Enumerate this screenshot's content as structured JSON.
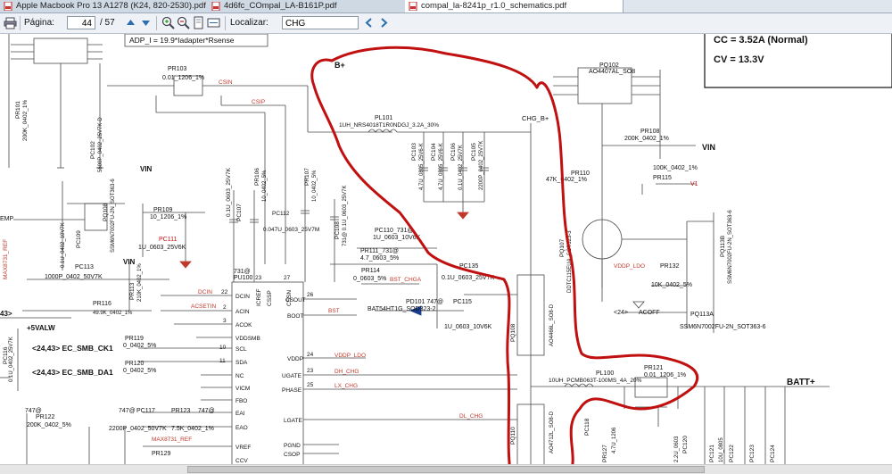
{
  "tabs": [
    {
      "label": "Apple Macbook Pro 13 A1278 (K24, 820-2530).pdf",
      "active": false
    },
    {
      "label": "4d6fc_COmpal_LA-B161P.pdf",
      "active": false
    },
    {
      "label": "compal_la-8241p_r1.0_schematics.pdf",
      "active": true
    }
  ],
  "toolbar": {
    "page_label": "Página:",
    "page_current": "44",
    "page_total": "/ 57",
    "search_label": "Localizar:",
    "search_value": "CHG"
  },
  "schematic": {
    "formula": "ADP_I = 19.9*Iadapter*Rsense",
    "note_cc": "CC = 3.52A (Normal)",
    "note_cv": "CV = 13.3V",
    "rails": {
      "bplus": "B+",
      "chg_bplus": "CHG_B+",
      "vin": "VIN",
      "batt": "BATT+",
      "valw": "+5VALW",
      "vin2": "VIN",
      "vin3": "VIN"
    },
    "nets": {
      "csin": "CSIN",
      "csip": "CSIP",
      "dcin": "DCIN",
      "acsetin": "ACSETIN",
      "bst_chga": "BST_CHGA",
      "bst": "BST",
      "vddp_ldo": "VDDP_LDO",
      "dh_chg": "DH_CHG",
      "lx_chg": "LX_CHG",
      "dl_chg": "DL_CHG",
      "vddp_ldo2": "VDDP_LDO",
      "acoff": "ACOFF",
      "v1": "V1",
      "max_ref": "MAX8731_REF",
      "max_ref2": "MAX8731_REF",
      "emp": "EMP"
    },
    "smb": {
      "ck": "<24,43> EC_SMB_CK1",
      "da": "<24,43> EC_SMB_DA1",
      "ref43": "43>",
      "ref24": "<24>"
    },
    "parts": {
      "pr101": "PR101",
      "pr101v": "200K_0402_1%",
      "pr103": "PR103",
      "pr103v": "0.01_1206_1%",
      "pc102": "PC102",
      "pc102v": "5600P_0402_25V7K-D",
      "pl101": "PL101",
      "pl101v": "1UH_NRS4018T1R0NDGJ_3.2A_30%",
      "pc103": "PC103",
      "pc103v": "4.7U_0805_25V6-K",
      "pc104": "PC104",
      "pc104v": "4.7U_0805_25V6-K",
      "pc106": "PC106",
      "pc106v": "0.1U_0402_25V7K",
      "pc105": "PC105",
      "pc105v": "2200P_0402_25V7K",
      "pq102": "PQ102",
      "pq102v": "AO4407AL_SO8",
      "pr108": "PR108",
      "pr108v": "200K_0402_1%",
      "pr110": "PR110",
      "pr110v": "47K_0402_1%",
      "pr115": "PR115",
      "pr115v": "100K_0402_1%",
      "pq107": "PQ107",
      "pq107v": "DDTC115EUA_SOT323-3",
      "pq113b": "PQ113B",
      "pq113bv": "SSM6N7002FU-2N_SOT363-6",
      "pr132": "PR132",
      "pr132v": "10K_0402_5%",
      "pq113a": "PQ113A",
      "pq113av": "SSM6N7002FU-2N_SOT363-6",
      "pr109": "PR109",
      "pr109v": "10_1206_1%",
      "pc111": "PC111",
      "pc111v": "1U_0603_25V6K",
      "pc107": "PC107",
      "pc107v": "0.1U_0603_25V7K",
      "pr106": "PR106",
      "pr106v": "10_0402_5%",
      "pr107": "PR107",
      "pr107v": "10_0402_5%",
      "pc112": "PC112",
      "pc112v": "0.047U_0603_25V7M",
      "pc108": "PC108",
      "pc108v": "731@ 0.1U_0603_25V7K",
      "pc110": "PC110_731@",
      "pc110v": "1U_0603_10V6K",
      "pr111": "PR111_731@",
      "pr111v": "4.7_0603_5%",
      "pr114": "PR114",
      "pr114v": "0_0603_5%",
      "pd101": "PD101 747@",
      "pd101v": "BAT54HT1G_SOD323-2",
      "pc115": "PC115",
      "pc115v": "1U_0603_10V6K",
      "pc135": "PC135",
      "pc135v": "0.1U_0603_25V7K",
      "pc109": "PC109",
      "pc109v": "0.1U_0402_10V7K",
      "pq108": "PQ108",
      "pq108v": "SSM6N7002FU-2N_SOT363-6",
      "pc113": "PC113",
      "pc113v": "1000P_0402_50V7K",
      "pr113": "PR113",
      "pr113v": "210K_0402_1%",
      "pr116": "PR116",
      "pr116v": "49.9K_0402_1%",
      "pr119": "PR119",
      "pr119v": "0_0402_5%",
      "pr120": "PR120",
      "pr120v": "0_0402_5%",
      "pr122": "PR122",
      "pr122v": "200K_0402_5%",
      "pc116": "PC116",
      "pc116v": "0.1U_0402_25V7K",
      "pc117": "PC117",
      "pc117v": "2200P_0402_50V7K",
      "pr123": "PR123",
      "pr123v": "7.5K_0402_1%",
      "pr129": "PR129",
      "pu100": "PU100",
      "pq108b": "PQ108",
      "pq108bv": "AO4466L_SO8-D",
      "pq110": "PQ110",
      "pq110v": "AO4712L_SO8-D",
      "pl100": "PL100",
      "pl100v": "10UH_PCMB063T-100MS_4A_20%",
      "pr121": "PR121",
      "pr121v": "0.01_1206_1%",
      "pc118": "PC118",
      "pc120": "PC120",
      "pc121": "PC121",
      "pc122": "PC122",
      "pc123": "PC123",
      "pc124": "PC124",
      "pr127": "PR127",
      "at731": "731@",
      "at747": "747@",
      "at747b": "747@",
      "at747c": "747@",
      "cap_4u7": "4.7U_1206",
      "cap_10u": "10U_0805",
      "cap_2u2": "2.2U_0603"
    },
    "ic_pins": [
      {
        "num": "22",
        "name": "DCIN"
      },
      {
        "num": "2",
        "name": "ACIN"
      },
      {
        "num": "3",
        "name": "ACOK"
      },
      {
        "num": "",
        "name": "VDDSMB"
      },
      {
        "num": "10",
        "name": "SCL"
      },
      {
        "num": "11",
        "name": "SDA"
      },
      {
        "num": "",
        "name": "NC"
      },
      {
        "num": "",
        "name": "VICM"
      },
      {
        "num": "",
        "name": "FBO"
      },
      {
        "num": "",
        "name": "EAI"
      },
      {
        "num": "",
        "name": "EAO"
      },
      {
        "num": "",
        "name": "VREF"
      },
      {
        "num": "",
        "name": "CCV"
      }
    ],
    "ic_right_pins": [
      {
        "num": "26",
        "name": "CSOUT"
      },
      {
        "num": "",
        "name": "BOOT"
      },
      {
        "num": "24",
        "name": "VDDP"
      },
      {
        "num": "23",
        "name": "UGATE"
      },
      {
        "num": "25",
        "name": "PHASE"
      },
      {
        "num": "",
        "name": "LGATE"
      },
      {
        "num": "",
        "name": "PGND"
      },
      {
        "num": "",
        "name": "CSOP"
      }
    ],
    "ic_top_pins": [
      {
        "num": "23",
        "name": "ICREF"
      },
      {
        "num": "",
        "name": "CSSP"
      },
      {
        "num": "27",
        "name": "CSSN"
      }
    ],
    "ic_top_nums": [
      "731@",
      "PU100"
    ]
  },
  "colors": {
    "net_red": "#c0392b",
    "wire": "#4a4a4a",
    "ink": "#111111",
    "annot": "#c01010"
  }
}
